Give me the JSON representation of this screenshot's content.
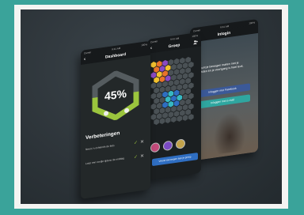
{
  "colors": {
    "background_teal": "#3aa39a",
    "accent_green": "#9bc53d",
    "facebook_blue": "#3b5998",
    "mail_teal": "#2fa6a0"
  },
  "phone1": {
    "status_left": "Carrier",
    "status_time": "9:41 AM",
    "status_right": "100%",
    "title": "Dashboard",
    "back_icon": "chevron-left-icon",
    "progress_value": "45%",
    "progress_fraction": 0.45,
    "section_title": "Verbeteringen",
    "items": [
      {
        "text": "Neem 's ochtends de fiets"
      },
      {
        "text": "Loop een rondje tijdens de middag"
      }
    ]
  },
  "phone2": {
    "status_left": "Carrier",
    "status_time": "9:41 AM",
    "status_right": "100%",
    "title": "Groep",
    "add_user_icon": "add-user-icon",
    "member_name": "Bas",
    "invite_label": "Vriend toevoegen aan je groep"
  },
  "phone3": {
    "status_left": "Carrier",
    "status_time": "9:41 AM",
    "status_right": "100%",
    "title": "Inlogin",
    "intro_text": "Je kunt je bewegen maken met je vrienden en je voortgang is heel leuk.",
    "facebook_label": "Inloggen met Facebook",
    "mail_label": "Inloggen met e-mail"
  }
}
